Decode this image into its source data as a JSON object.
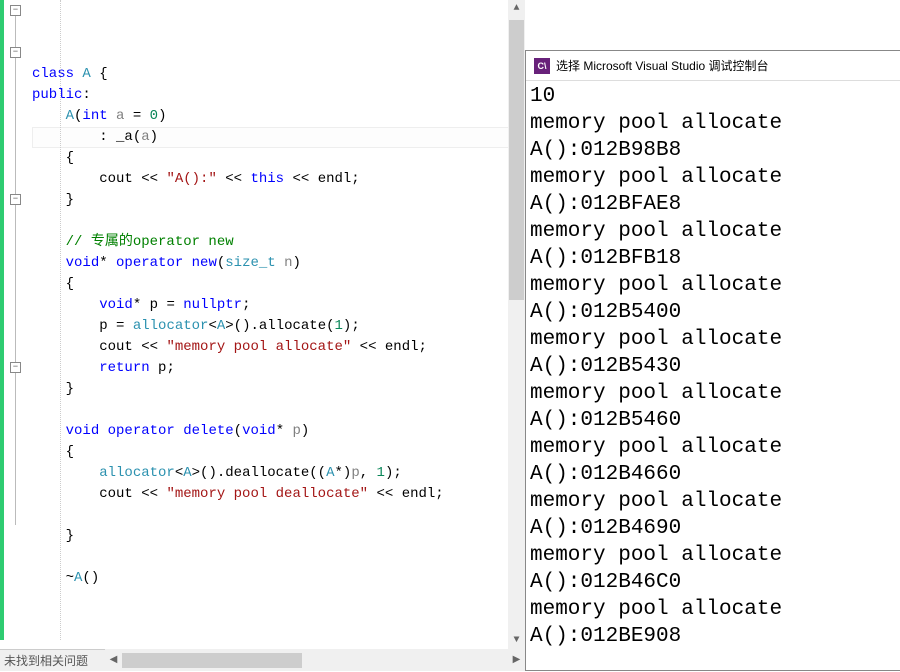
{
  "editor": {
    "lines": [
      {
        "segs": [
          {
            "t": "class ",
            "c": "kw"
          },
          {
            "t": "A",
            "c": "cls"
          },
          {
            "t": " {",
            "c": "op"
          }
        ]
      },
      {
        "segs": [
          {
            "t": "public",
            "c": "kw"
          },
          {
            "t": ":",
            "c": "op"
          }
        ]
      },
      {
        "segs": [
          {
            "t": "    ",
            "c": ""
          },
          {
            "t": "A",
            "c": "cls"
          },
          {
            "t": "(",
            "c": "op"
          },
          {
            "t": "int",
            "c": "type"
          },
          {
            "t": " ",
            "c": ""
          },
          {
            "t": "a",
            "c": "param"
          },
          {
            "t": " = ",
            "c": "op"
          },
          {
            "t": "0",
            "c": "num"
          },
          {
            "t": ")",
            "c": "op"
          }
        ]
      },
      {
        "segs": [
          {
            "t": "        : ",
            "c": ""
          },
          {
            "t": "_a",
            "c": "ident"
          },
          {
            "t": "(",
            "c": "op"
          },
          {
            "t": "a",
            "c": "param"
          },
          {
            "t": ")",
            "c": "op"
          }
        ],
        "hl": true
      },
      {
        "segs": [
          {
            "t": "    {",
            "c": ""
          }
        ]
      },
      {
        "segs": [
          {
            "t": "        ",
            "c": ""
          },
          {
            "t": "cout",
            "c": "ident"
          },
          {
            "t": " << ",
            "c": "op"
          },
          {
            "t": "\"A():\"",
            "c": "str"
          },
          {
            "t": " << ",
            "c": "op"
          },
          {
            "t": "this",
            "c": "kw"
          },
          {
            "t": " << ",
            "c": "op"
          },
          {
            "t": "endl",
            "c": "ident"
          },
          {
            "t": ";",
            "c": "op"
          }
        ]
      },
      {
        "segs": [
          {
            "t": "    }",
            "c": ""
          }
        ]
      },
      {
        "segs": [
          {
            "t": "",
            "c": ""
          }
        ]
      },
      {
        "segs": [
          {
            "t": "    ",
            "c": ""
          },
          {
            "t": "// 专属的operator new",
            "c": "com"
          }
        ]
      },
      {
        "segs": [
          {
            "t": "    ",
            "c": ""
          },
          {
            "t": "void",
            "c": "type"
          },
          {
            "t": "* ",
            "c": "op"
          },
          {
            "t": "operator",
            "c": "kw"
          },
          {
            "t": " ",
            "c": ""
          },
          {
            "t": "new",
            "c": "kw"
          },
          {
            "t": "(",
            "c": "op"
          },
          {
            "t": "size_t",
            "c": "cls"
          },
          {
            "t": " ",
            "c": ""
          },
          {
            "t": "n",
            "c": "param"
          },
          {
            "t": ")",
            "c": "op"
          }
        ]
      },
      {
        "segs": [
          {
            "t": "    {",
            "c": ""
          }
        ]
      },
      {
        "segs": [
          {
            "t": "        ",
            "c": ""
          },
          {
            "t": "void",
            "c": "type"
          },
          {
            "t": "* ",
            "c": "op"
          },
          {
            "t": "p",
            "c": "ident"
          },
          {
            "t": " = ",
            "c": "op"
          },
          {
            "t": "nullptr",
            "c": "kw"
          },
          {
            "t": ";",
            "c": "op"
          }
        ]
      },
      {
        "segs": [
          {
            "t": "        ",
            "c": ""
          },
          {
            "t": "p",
            "c": "ident"
          },
          {
            "t": " = ",
            "c": "op"
          },
          {
            "t": "allocator",
            "c": "cls"
          },
          {
            "t": "<",
            "c": "op"
          },
          {
            "t": "A",
            "c": "cls"
          },
          {
            "t": ">().",
            "c": "op"
          },
          {
            "t": "allocate",
            "c": "fn"
          },
          {
            "t": "(",
            "c": "op"
          },
          {
            "t": "1",
            "c": "num"
          },
          {
            "t": ");",
            "c": "op"
          }
        ]
      },
      {
        "segs": [
          {
            "t": "        ",
            "c": ""
          },
          {
            "t": "cout",
            "c": "ident"
          },
          {
            "t": " << ",
            "c": "op"
          },
          {
            "t": "\"memory pool allocate\"",
            "c": "str"
          },
          {
            "t": " << ",
            "c": "op"
          },
          {
            "t": "endl",
            "c": "ident"
          },
          {
            "t": ";",
            "c": "op"
          }
        ]
      },
      {
        "segs": [
          {
            "t": "        ",
            "c": ""
          },
          {
            "t": "return",
            "c": "kw"
          },
          {
            "t": " ",
            "c": ""
          },
          {
            "t": "p",
            "c": "ident"
          },
          {
            "t": ";",
            "c": "op"
          }
        ]
      },
      {
        "segs": [
          {
            "t": "    }",
            "c": ""
          }
        ]
      },
      {
        "segs": [
          {
            "t": "",
            "c": ""
          }
        ]
      },
      {
        "segs": [
          {
            "t": "    ",
            "c": ""
          },
          {
            "t": "void",
            "c": "type"
          },
          {
            "t": " ",
            "c": ""
          },
          {
            "t": "operator",
            "c": "kw"
          },
          {
            "t": " ",
            "c": ""
          },
          {
            "t": "delete",
            "c": "kw"
          },
          {
            "t": "(",
            "c": "op"
          },
          {
            "t": "void",
            "c": "type"
          },
          {
            "t": "* ",
            "c": "op"
          },
          {
            "t": "p",
            "c": "param"
          },
          {
            "t": ")",
            "c": "op"
          }
        ]
      },
      {
        "segs": [
          {
            "t": "    {",
            "c": ""
          }
        ]
      },
      {
        "segs": [
          {
            "t": "        ",
            "c": ""
          },
          {
            "t": "allocator",
            "c": "cls"
          },
          {
            "t": "<",
            "c": "op"
          },
          {
            "t": "A",
            "c": "cls"
          },
          {
            "t": ">().",
            "c": "op"
          },
          {
            "t": "deallocate",
            "c": "fn"
          },
          {
            "t": "((",
            "c": "op"
          },
          {
            "t": "A",
            "c": "cls"
          },
          {
            "t": "*)",
            "c": "op"
          },
          {
            "t": "p",
            "c": "param"
          },
          {
            "t": ", ",
            "c": "op"
          },
          {
            "t": "1",
            "c": "num"
          },
          {
            "t": ");",
            "c": "op"
          }
        ]
      },
      {
        "segs": [
          {
            "t": "        ",
            "c": ""
          },
          {
            "t": "cout",
            "c": "ident"
          },
          {
            "t": " << ",
            "c": "op"
          },
          {
            "t": "\"memory pool deallocate\"",
            "c": "str"
          },
          {
            "t": " << ",
            "c": "op"
          },
          {
            "t": "endl",
            "c": "ident"
          },
          {
            "t": ";",
            "c": "op"
          }
        ]
      },
      {
        "segs": [
          {
            "t": "",
            "c": ""
          }
        ]
      },
      {
        "segs": [
          {
            "t": "    }",
            "c": "op"
          }
        ]
      },
      {
        "segs": [
          {
            "t": "",
            "c": ""
          }
        ]
      },
      {
        "segs": [
          {
            "t": "    ~",
            "c": "op"
          },
          {
            "t": "A",
            "c": "cls"
          },
          {
            "t": "()",
            "c": "op"
          }
        ]
      }
    ],
    "fold_markers": [
      0,
      2,
      9,
      17
    ],
    "status_text": "未找到相关问题"
  },
  "console": {
    "icon_text": "C\\",
    "title": "选择 Microsoft Visual Studio 调试控制台",
    "lines": [
      "10",
      "memory pool allocate",
      "A():012B98B8",
      "memory pool allocate",
      "A():012BFAE8",
      "memory pool allocate",
      "A():012BFB18",
      "memory pool allocate",
      "A():012B5400",
      "memory pool allocate",
      "A():012B5430",
      "memory pool allocate",
      "A():012B5460",
      "memory pool allocate",
      "A():012B4660",
      "memory pool allocate",
      "A():012B4690",
      "memory pool allocate",
      "A():012B46C0",
      "memory pool allocate",
      "A():012BE908"
    ]
  }
}
